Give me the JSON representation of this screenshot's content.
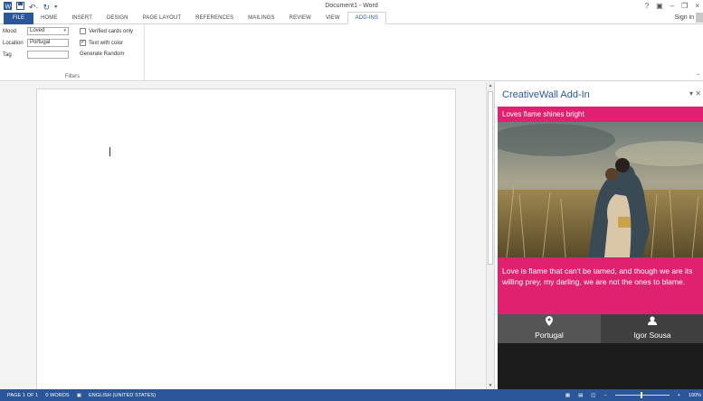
{
  "window": {
    "title": "Document1 - Word",
    "controls": [
      "?",
      "▣",
      "–",
      "❐",
      "×"
    ]
  },
  "ribbon": {
    "tabs": [
      "FILE",
      "HOME",
      "INSERT",
      "DESIGN",
      "PAGE LAYOUT",
      "REFERENCES",
      "MAILINGS",
      "REVIEW",
      "VIEW",
      "ADD-INS"
    ],
    "active_tab": "ADD-INS",
    "sign_in": "Sign in",
    "filters": {
      "mood_label": "Mood",
      "mood_value": "Loved",
      "location_label": "Location",
      "location_value": "Portugal",
      "tag_label": "Tag",
      "tag_value": "",
      "verified_label": "Verified cards only",
      "verified_checked": false,
      "text_color_label": "Text with color",
      "text_color_checked": true,
      "generate_label": "Generate Random",
      "group_label": "Filters"
    }
  },
  "pane": {
    "title": "CreativeWall Add-In",
    "card": {
      "headline": "Loves flame shines bright",
      "quote": "Love is flame that can't be tamed, and though we are its willing prey, my darling, we are not the ones to blame.",
      "location": "Portugal",
      "author": "Igor Sousa",
      "accent": "#e0216f"
    }
  },
  "status": {
    "page": "PAGE 1 OF 1",
    "words": "0 WORDS",
    "language": "ENGLISH (UNITED STATES)",
    "zoom": "100%"
  }
}
